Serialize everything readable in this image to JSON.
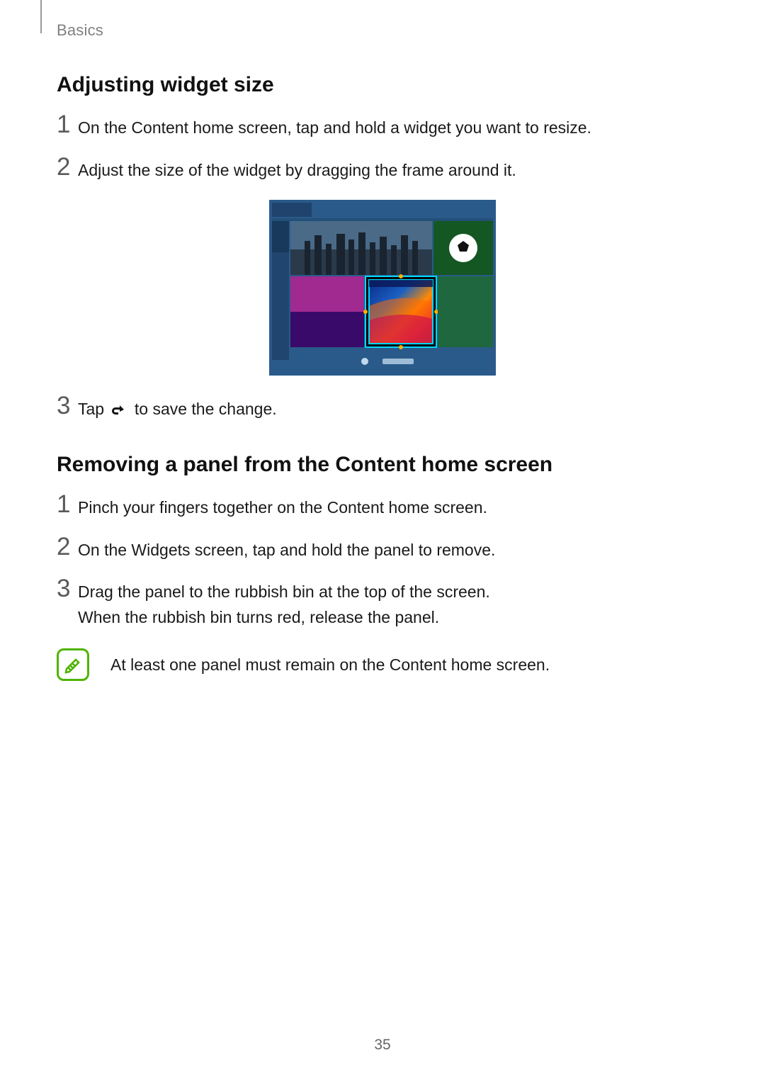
{
  "header": "Basics",
  "section_a": {
    "title": "Adjusting widget size",
    "steps": [
      "On the Content home screen, tap and hold a widget you want to resize.",
      "Adjust the size of the widget by dragging the frame around it."
    ],
    "step3_prefix": "Tap ",
    "step3_suffix": " to save the change."
  },
  "section_b": {
    "title": "Removing a panel from the Content home screen",
    "steps": [
      "Pinch your fingers together on the Content home screen.",
      "On the Widgets screen, tap and hold the panel to remove.",
      "Drag the panel to the rubbish bin at the top of the screen.\nWhen the rubbish bin turns red, release the panel."
    ]
  },
  "note": "At least one panel must remain on the Content home screen.",
  "page_number": "35"
}
